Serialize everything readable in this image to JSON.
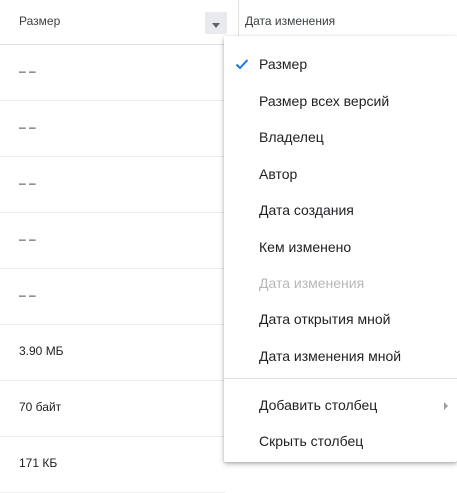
{
  "header": {
    "size_col_label": "Размер",
    "date_col_label": "Дата изменения"
  },
  "rows": [
    {
      "size": "– –"
    },
    {
      "size": "– –"
    },
    {
      "size": "– –"
    },
    {
      "size": "– –"
    },
    {
      "size": "– –"
    },
    {
      "size": "3.90 МБ"
    },
    {
      "size": "70 байт"
    },
    {
      "size": "171 КБ"
    }
  ],
  "menu": {
    "items": [
      {
        "label": "Размер",
        "checked": true
      },
      {
        "label": "Размер всех версий"
      },
      {
        "label": "Владелец"
      },
      {
        "label": "Автор"
      },
      {
        "label": "Дата создания"
      },
      {
        "label": "Кем изменено"
      },
      {
        "label": "Дата изменения",
        "disabled": true
      },
      {
        "label": "Дата открытия мной"
      },
      {
        "label": "Дата изменения мной"
      },
      {
        "label": "Добавить столбец",
        "submenu": true
      },
      {
        "label": "Скрыть столбец"
      }
    ]
  },
  "colors": {
    "accent": "#1a73e8",
    "disabled_text": "#b8b8b8"
  },
  "icons": {
    "check": "check-icon",
    "sort": "sort-down-icon",
    "submenu": "chevron-right-icon"
  }
}
